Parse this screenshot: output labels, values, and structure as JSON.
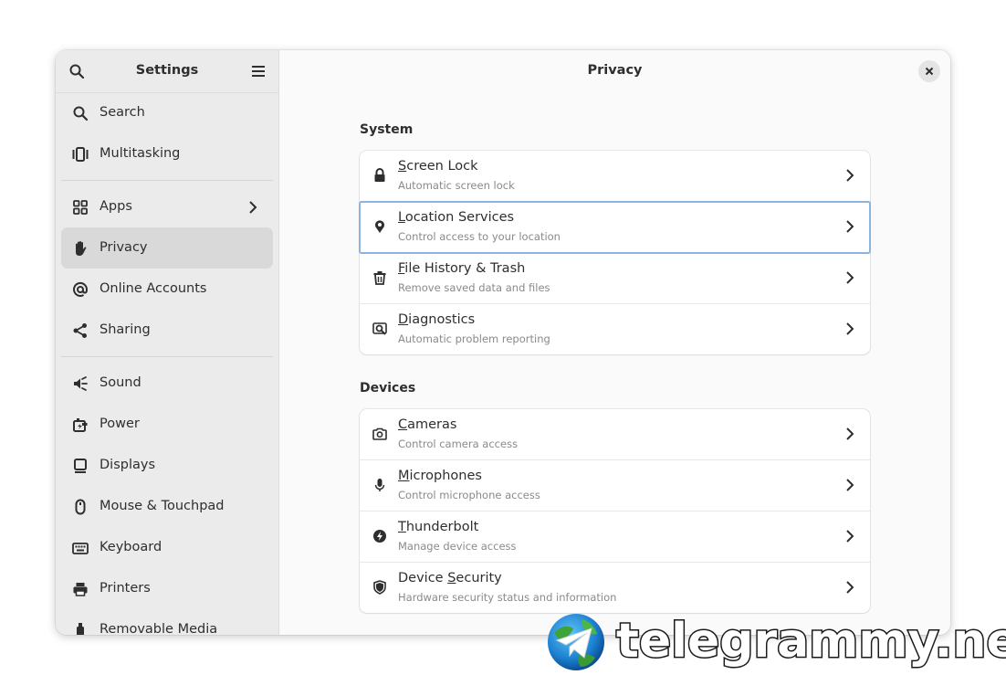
{
  "sidebar": {
    "title": "Settings",
    "groups": [
      [
        {
          "label": "Search",
          "icon": "search-icon"
        },
        {
          "label": "Multitasking",
          "icon": "multitasking-icon"
        }
      ],
      [
        {
          "label": "Apps",
          "icon": "apps-icon",
          "has_chevron": true
        },
        {
          "label": "Privacy",
          "icon": "hand-icon",
          "selected": true
        },
        {
          "label": "Online Accounts",
          "icon": "at-icon"
        },
        {
          "label": "Sharing",
          "icon": "share-icon"
        }
      ],
      [
        {
          "label": "Sound",
          "icon": "speaker-icon"
        },
        {
          "label": "Power",
          "icon": "power-icon"
        },
        {
          "label": "Displays",
          "icon": "display-icon"
        },
        {
          "label": "Mouse & Touchpad",
          "icon": "mouse-icon"
        },
        {
          "label": "Keyboard",
          "icon": "keyboard-icon"
        },
        {
          "label": "Printers",
          "icon": "printer-icon"
        },
        {
          "label": "Removable Media",
          "icon": "usb-icon"
        }
      ]
    ]
  },
  "content": {
    "title": "Privacy",
    "groups": [
      {
        "title": "System",
        "rows": [
          {
            "title": "Screen Lock",
            "mnemonic_first": "S",
            "mnemonic_rest": "creen Lock",
            "subtitle": "Automatic screen lock",
            "icon": "lock-icon"
          },
          {
            "title": "Location Services",
            "mnemonic_first": "L",
            "mnemonic_rest": "ocation Services",
            "subtitle": "Control access to your location",
            "icon": "location-icon",
            "focused": true
          },
          {
            "title": "File History & Trash",
            "mnemonic_first": "F",
            "mnemonic_rest": "ile History & Trash",
            "subtitle": "Remove saved data and files",
            "icon": "trash-icon"
          },
          {
            "title": "Diagnostics",
            "mnemonic_first": "D",
            "mnemonic_rest": "iagnostics",
            "subtitle": "Automatic problem reporting",
            "icon": "diagnostics-icon"
          }
        ]
      },
      {
        "title": "Devices",
        "rows": [
          {
            "title": "Cameras",
            "mnemonic_first": "C",
            "mnemonic_rest": "ameras",
            "subtitle": "Control camera access",
            "icon": "camera-icon"
          },
          {
            "title": "Microphones",
            "mnemonic_first": "M",
            "mnemonic_rest": "icrophones",
            "subtitle": "Control microphone access",
            "icon": "microphone-icon"
          },
          {
            "title": "Thunderbolt",
            "mnemonic_first": "T",
            "mnemonic_rest": "hunderbolt",
            "subtitle": "Manage device access",
            "icon": "thunderbolt-icon"
          },
          {
            "title": "Device Security",
            "mnemonic_pre": "Device ",
            "mnemonic_first": "S",
            "mnemonic_rest": "ecurity",
            "subtitle": "Hardware security status and information",
            "icon": "shield-icon"
          }
        ]
      }
    ]
  },
  "watermark": {
    "text": "telegrammy.net",
    "icon": "telegram-globe-icon"
  }
}
